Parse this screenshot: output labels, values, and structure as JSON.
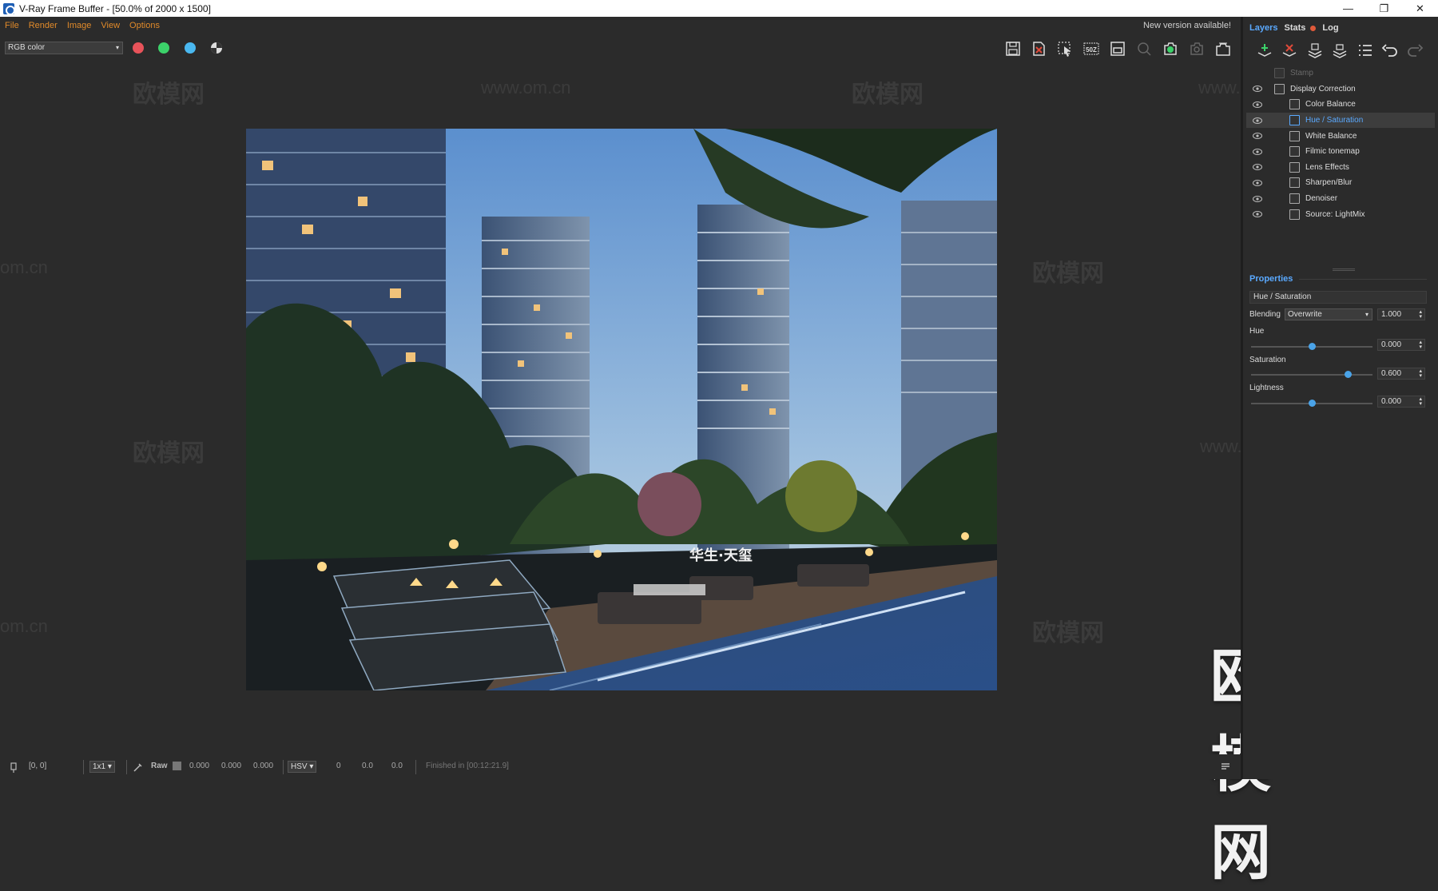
{
  "window": {
    "title": "V-Ray Frame Buffer - [50.0% of 2000 x 1500]",
    "controls": [
      "—",
      "❐",
      "✕"
    ]
  },
  "menu": {
    "items": [
      "File",
      "Render",
      "Image",
      "View",
      "Options"
    ],
    "new_version": "New version available!"
  },
  "toolbar": {
    "channel": "RGB color",
    "channel_colors": {
      "red": "#e8535a",
      "green": "#3cd26a",
      "blue": "#4ab8f0"
    },
    "icons": [
      "save-icon",
      "clear-icon",
      "region-select-icon",
      "zoom-50-icon",
      "frame-icon",
      "track-mouse-icon",
      "render-icon",
      "render-interactive-icon",
      "stop-render-icon"
    ],
    "zoom_label": "50Z"
  },
  "watermarks": {
    "cn": "欧模网",
    "url": "www.om.cn",
    "url_partial": "om.cn",
    "url_prefix": "www.",
    "logo": "欧模网"
  },
  "render_sign": "华生·天玺",
  "statusbar": {
    "coords": "[0, 0]",
    "sample": "1x1",
    "raw_label": "Raw",
    "rgb": [
      "0.000",
      "0.000",
      "0.000"
    ],
    "colorspace": "HSV",
    "hsv": [
      "0",
      "0.0",
      "0.0"
    ],
    "finished": "Finished in [00:12:21.9]"
  },
  "panel": {
    "tabs": [
      "Layers",
      "Stats",
      "Log"
    ],
    "layers": [
      {
        "name": "Stamp",
        "visible": false,
        "disabled": true,
        "indent": 0
      },
      {
        "name": "Display Correction",
        "visible": true,
        "disabled": false,
        "indent": 0
      },
      {
        "name": "Color Balance",
        "visible": true,
        "disabled": false,
        "indent": 1
      },
      {
        "name": "Hue / Saturation",
        "visible": true,
        "disabled": false,
        "indent": 1,
        "selected": true
      },
      {
        "name": "White Balance",
        "visible": true,
        "disabled": false,
        "indent": 1
      },
      {
        "name": "Filmic tonemap",
        "visible": true,
        "disabled": false,
        "indent": 1
      },
      {
        "name": "Lens Effects",
        "visible": true,
        "disabled": false,
        "indent": 1
      },
      {
        "name": "Sharpen/Blur",
        "visible": true,
        "disabled": false,
        "indent": 1
      },
      {
        "name": "Denoiser",
        "visible": true,
        "disabled": false,
        "indent": 1
      },
      {
        "name": "Source: LightMix",
        "visible": true,
        "disabled": false,
        "indent": 1
      }
    ],
    "properties": {
      "title": "Properties",
      "layer_name": "Hue / Saturation",
      "blending_label": "Blending",
      "blending_mode": "Overwrite",
      "blending_amount": "1.000",
      "hue_label": "Hue",
      "hue_value": "0.000",
      "hue_position": 0.5,
      "saturation_label": "Saturation",
      "saturation_value": "0.600",
      "saturation_position": 0.8,
      "lightness_label": "Lightness",
      "lightness_value": "0.000",
      "lightness_position": 0.5
    }
  }
}
